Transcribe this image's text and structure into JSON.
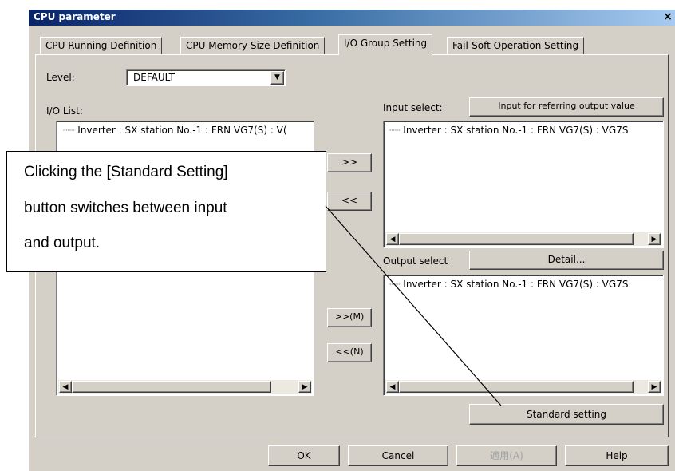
{
  "window": {
    "title": "CPU parameter",
    "close": "×"
  },
  "tabs": [
    {
      "label": "CPU Running Definition"
    },
    {
      "label": "CPU Memory Size Definition"
    },
    {
      "label": "I/O Group Setting"
    },
    {
      "label": "Fail-Soft Operation Setting"
    }
  ],
  "level": {
    "label": "Level:",
    "value": "DEFAULT",
    "arrow": "▼"
  },
  "io_list": {
    "label": "I/O List:",
    "items": [
      "Inverter : SX station No.-1 : FRN VG7(S) : V("
    ]
  },
  "input_select": {
    "label": "Input select:",
    "ref_button": "Input for referring output value",
    "items": [
      "Inverter : SX station No.-1 : FRN VG7(S) : VG7S"
    ]
  },
  "output_select": {
    "label": "Output select",
    "detail_button": "Detail...",
    "items": [
      "Inverter : SX station No.-1 : FRN VG7(S) : VG7S"
    ]
  },
  "move_buttons": {
    "add_input": ">>",
    "remove_input": "<<",
    "add_output": ">>(M)",
    "remove_output": "<<(N)"
  },
  "standard_setting_button": "Standard setting",
  "callout": {
    "line1": "Clicking the [Standard Setting]",
    "line2": "button switches between input",
    "line3": "and output."
  },
  "footer": {
    "ok": "OK",
    "cancel": "Cancel",
    "apply": "適用(A)",
    "help": "Help"
  },
  "scroll": {
    "left": "◀",
    "right": "▶"
  }
}
